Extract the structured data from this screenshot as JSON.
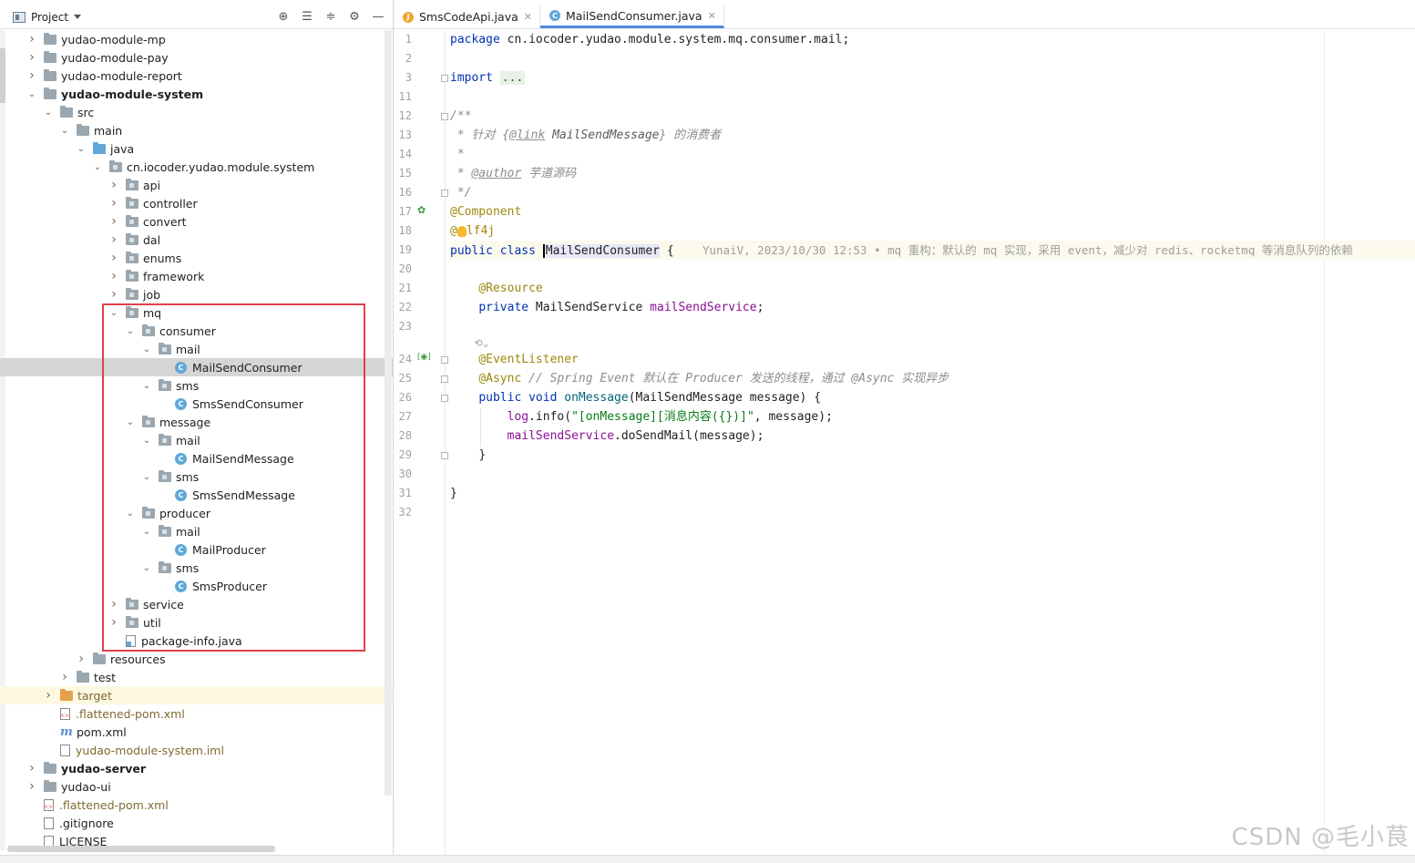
{
  "project_panel": {
    "title": "Project",
    "tools": [
      "locate-icon",
      "expand-all-icon",
      "collapse-all-icon",
      "gear-icon",
      "minimize-icon"
    ]
  },
  "tree": [
    {
      "label": "yudao-module-mp",
      "depth": 1,
      "arrow": "right",
      "icon": "folder"
    },
    {
      "label": "yudao-module-pay",
      "depth": 1,
      "arrow": "right",
      "icon": "folder"
    },
    {
      "label": "yudao-module-report",
      "depth": 1,
      "arrow": "right",
      "icon": "folder"
    },
    {
      "label": "yudao-module-system",
      "depth": 1,
      "arrow": "down",
      "icon": "folder",
      "bold": true
    },
    {
      "label": "src",
      "depth": 2,
      "arrow": "down",
      "icon": "folder"
    },
    {
      "label": "main",
      "depth": 3,
      "arrow": "down",
      "icon": "folder"
    },
    {
      "label": "java",
      "depth": 4,
      "arrow": "down",
      "icon": "java"
    },
    {
      "label": "cn.iocoder.yudao.module.system",
      "depth": 5,
      "arrow": "down",
      "icon": "pkg"
    },
    {
      "label": "api",
      "depth": 6,
      "arrow": "right",
      "icon": "pkg"
    },
    {
      "label": "controller",
      "depth": 6,
      "arrow": "right",
      "icon": "pkg"
    },
    {
      "label": "convert",
      "depth": 6,
      "arrow": "right",
      "icon": "pkg"
    },
    {
      "label": "dal",
      "depth": 6,
      "arrow": "right",
      "icon": "pkg"
    },
    {
      "label": "enums",
      "depth": 6,
      "arrow": "right",
      "icon": "pkg"
    },
    {
      "label": "framework",
      "depth": 6,
      "arrow": "right",
      "icon": "pkg"
    },
    {
      "label": "job",
      "depth": 6,
      "arrow": "right",
      "icon": "pkg"
    },
    {
      "label": "mq",
      "depth": 6,
      "arrow": "down",
      "icon": "pkg"
    },
    {
      "label": "consumer",
      "depth": 7,
      "arrow": "down",
      "icon": "pkg"
    },
    {
      "label": "mail",
      "depth": 8,
      "arrow": "down",
      "icon": "pkg"
    },
    {
      "label": "MailSendConsumer",
      "depth": 9,
      "arrow": "none",
      "icon": "class",
      "selected": true
    },
    {
      "label": "sms",
      "depth": 8,
      "arrow": "down",
      "icon": "pkg"
    },
    {
      "label": "SmsSendConsumer",
      "depth": 9,
      "arrow": "none",
      "icon": "class"
    },
    {
      "label": "message",
      "depth": 7,
      "arrow": "down",
      "icon": "pkg"
    },
    {
      "label": "mail",
      "depth": 8,
      "arrow": "down",
      "icon": "pkg"
    },
    {
      "label": "MailSendMessage",
      "depth": 9,
      "arrow": "none",
      "icon": "class"
    },
    {
      "label": "sms",
      "depth": 8,
      "arrow": "down",
      "icon": "pkg"
    },
    {
      "label": "SmsSendMessage",
      "depth": 9,
      "arrow": "none",
      "icon": "class"
    },
    {
      "label": "producer",
      "depth": 7,
      "arrow": "down",
      "icon": "pkg"
    },
    {
      "label": "mail",
      "depth": 8,
      "arrow": "down",
      "icon": "pkg"
    },
    {
      "label": "MailProducer",
      "depth": 9,
      "arrow": "none",
      "icon": "class"
    },
    {
      "label": "sms",
      "depth": 8,
      "arrow": "down",
      "icon": "pkg"
    },
    {
      "label": "SmsProducer",
      "depth": 9,
      "arrow": "none",
      "icon": "class"
    },
    {
      "label": "service",
      "depth": 6,
      "arrow": "right",
      "icon": "pkg"
    },
    {
      "label": "util",
      "depth": 6,
      "arrow": "right",
      "icon": "pkg"
    },
    {
      "label": "package-info.java",
      "depth": 6,
      "arrow": "none",
      "icon": "javafile"
    },
    {
      "label": "resources",
      "depth": 4,
      "arrow": "right",
      "icon": "folder"
    },
    {
      "label": "test",
      "depth": 3,
      "arrow": "right",
      "icon": "folder"
    },
    {
      "label": "target",
      "depth": 2,
      "arrow": "right",
      "icon": "orange",
      "highlighted": true,
      "muted": true
    },
    {
      "label": ".flattened-pom.xml",
      "depth": 2,
      "arrow": "none",
      "icon": "xml",
      "muted": true
    },
    {
      "label": "pom.xml",
      "depth": 2,
      "arrow": "none",
      "icon": "maven"
    },
    {
      "label": "yudao-module-system.iml",
      "depth": 2,
      "arrow": "none",
      "icon": "file",
      "muted": true
    },
    {
      "label": "yudao-server",
      "depth": 1,
      "arrow": "right",
      "icon": "folder",
      "bold": true
    },
    {
      "label": "yudao-ui",
      "depth": 1,
      "arrow": "right",
      "icon": "folder"
    },
    {
      "label": ".flattened-pom.xml",
      "depth": 1,
      "arrow": "none",
      "icon": "xml",
      "muted": true
    },
    {
      "label": ".gitignore",
      "depth": 1,
      "arrow": "none",
      "icon": "file"
    },
    {
      "label": "LICENSE",
      "depth": 1,
      "arrow": "none",
      "icon": "file"
    }
  ],
  "editor": {
    "tabs": [
      {
        "label": "SmsCodeApi.java",
        "active": false
      },
      {
        "label": "MailSendConsumer.java",
        "active": true
      }
    ],
    "line_numbers": [
      "1",
      "2",
      "3",
      "11",
      "12",
      "13",
      "14",
      "15",
      "16",
      "17",
      "18",
      "19",
      "20",
      "21",
      "22",
      "23",
      "",
      "24",
      "25",
      "26",
      "27",
      "28",
      "29",
      "30",
      "31",
      "32"
    ],
    "code": {
      "l1_kw": "package",
      "l1_rest": " cn.iocoder.yudao.module.system.mq.consumer.mail;",
      "l3_kw": "import",
      "l3_dots": "...",
      "l12": "/**",
      "l13_a": " * 针对 {",
      "l13_link": "@link",
      "l13_b": " MailSendMessage",
      "l13_c": "} 的消费者",
      "l14": " *",
      "l15_a": " * ",
      "l15_tag": "@author",
      "l15_b": " 芋道源码",
      "l16": " */",
      "l17": "@Component",
      "l18_a": "@",
      "l18_b": "lf4j",
      "l19_kw1": "public",
      "l19_kw2": "class",
      "l19_name": "MailSendConsumer",
      "l19_brace": " {",
      "l19_hint": "YunaiV, 2023/10/30 12:53 • mq 重构：默认的 mq 实现，采用 event，减少对 redis、rocketmq 等消息队列的依赖",
      "l21": "@Resource",
      "l22_kw": "private",
      "l22_type": " MailSendService ",
      "l22_field": "mailSendService",
      "l22_end": ";",
      "l24": "@EventListener",
      "l25_ann": "@Async",
      "l25_cmt": " // Spring Event 默认在 Producer 发送的线程，通过 @Async 实现异步",
      "l26_kw1": "public",
      "l26_kw2": "void",
      "l26_fn": "onMessage",
      "l26_rest": "(MailSendMessage message) {",
      "l27_field": "log",
      "l27_a": ".info(",
      "l27_str": "\"[onMessage][消息内容({})]\"",
      "l27_b": ", message);",
      "l28_field": "mailSendService",
      "l28_rest": ".doSendMail(message);",
      "l29": "}",
      "l31": "}"
    }
  },
  "watermark": "CSDN @毛小茛",
  "colors": {
    "keyword": "#0033b3",
    "annotation": "#9e880d",
    "string": "#067d17",
    "field": "#871094",
    "method": "#00627a",
    "comment": "#8c8c8c",
    "highlight_box": "#e0414b",
    "selection": "#d5d5d5"
  }
}
